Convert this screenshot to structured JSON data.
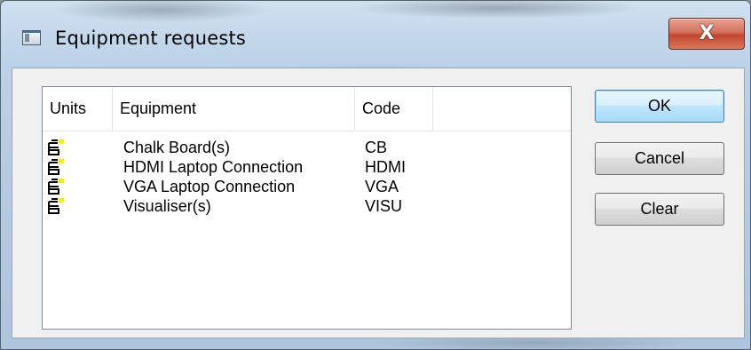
{
  "window": {
    "title": "Equipment requests",
    "close_label": "X"
  },
  "table": {
    "columns": [
      "Units",
      "Equipment",
      "Code",
      ""
    ],
    "rows": [
      {
        "equipment": "Chalk Board(s)",
        "code": "CB"
      },
      {
        "equipment": "HDMI Laptop Connection",
        "code": "HDMI"
      },
      {
        "equipment": "VGA Laptop Connection",
        "code": "VGA"
      },
      {
        "equipment": "Visualiser(s)",
        "code": "VISU"
      }
    ],
    "unit_icon": "unit-stack-icon"
  },
  "buttons": {
    "ok": "OK",
    "cancel": "Cancel",
    "clear": "Clear"
  },
  "colors": {
    "close_button": "#c1452e",
    "default_button": "#3c7fb1",
    "unit_icon_accent": "#ffee00"
  }
}
